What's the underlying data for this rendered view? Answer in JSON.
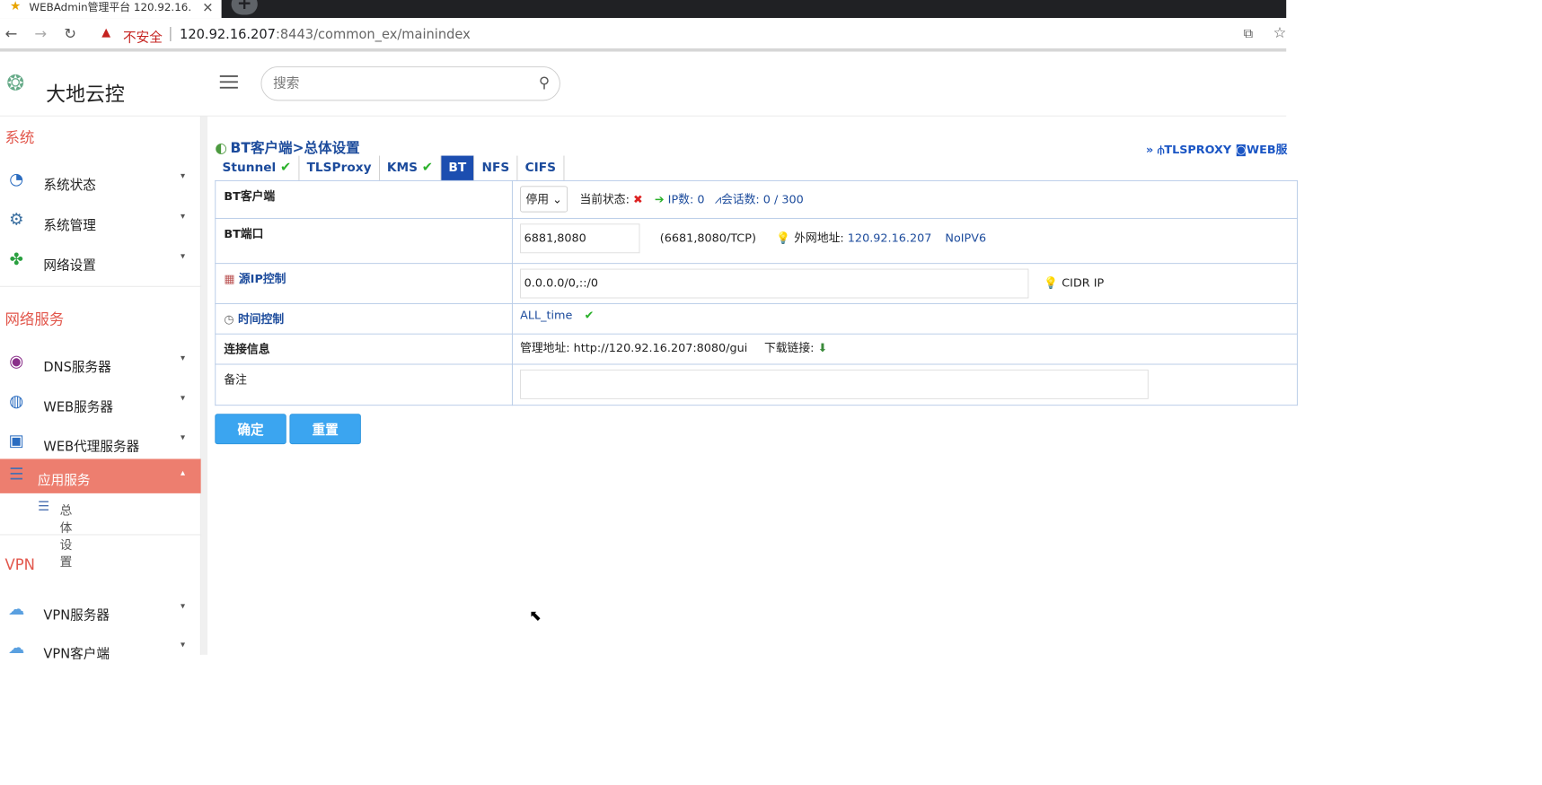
{
  "browser": {
    "tab_title": "WEBAdmin管理平台 120.92.16.",
    "insecure_label": "不安全",
    "url_host": "120.92.16.207",
    "url_rest": ":8443/common_ex/mainindex"
  },
  "header": {
    "brand": "大地云控",
    "search_placeholder": "搜索"
  },
  "sidebar": {
    "sections": [
      {
        "title": "系统",
        "items": [
          "系统状态",
          "系统管理",
          "网络设置"
        ]
      },
      {
        "title": "网络服务",
        "items": [
          "DNS服务器",
          "WEB服务器",
          "WEB代理服务器",
          "应用服务"
        ]
      },
      {
        "title": "VPN",
        "items": [
          "VPN服务器",
          "VPN客户端"
        ]
      }
    ],
    "active_item": "应用服务",
    "sub_item": "总体设置"
  },
  "content": {
    "page_title": "BT客户端>总体设置",
    "top_links": [
      "»",
      "TLSPROXY",
      "WEB服"
    ],
    "tabs": [
      "Stunnel",
      "TLSProxy",
      "KMS",
      "BT",
      "NFS",
      "CIFS"
    ],
    "active_tab": "BT",
    "rows": {
      "bt_client_label": "BT客户端",
      "bt_client_select": "停用",
      "status_label": "当前状态:",
      "ip_count_label": "IP数: 0",
      "session_label": "会话数: 0 / 300",
      "bt_port_label": "BT端口",
      "bt_port_value": "6881,8080",
      "bt_port_note": "(6681,8080/TCP)",
      "wan_label": "外网地址:",
      "wan_ip": "120.92.16.207",
      "no_ipv6": "NoIPV6",
      "src_ip_label": "源IP控制",
      "src_ip_value": "0.0.0.0/0,::/0",
      "cidr_note": "CIDR IP",
      "time_label": "时间控制",
      "time_value": "ALL_time",
      "conn_label": "连接信息",
      "mgmt_addr": "管理地址: http://120.92.16.207:8080/gui",
      "download_label": "下载链接:",
      "remark_label": "备注",
      "remark_value": ""
    },
    "confirm_button": "确定",
    "reset_button": "重置"
  },
  "colors": {
    "accent_red": "#e2574c",
    "active_bg": "#ed7e6f",
    "link_blue": "#1c4b9c",
    "button_blue": "#3ba5f0"
  }
}
